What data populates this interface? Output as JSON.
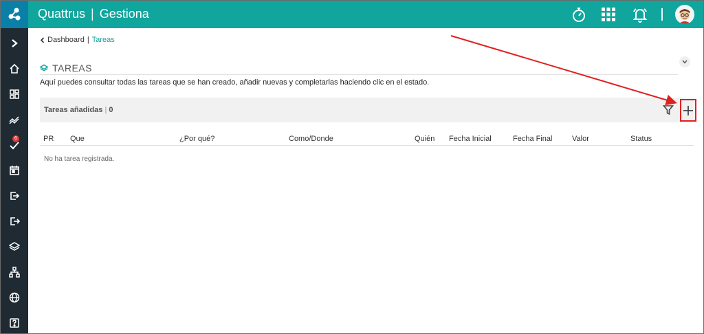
{
  "header": {
    "brand_name": "Quattrus",
    "brand_separator": "|",
    "module_name": "Gestiona",
    "icons": [
      "timer-icon",
      "apps-grid-icon",
      "bell-icon",
      "user-avatar"
    ]
  },
  "sidebar": {
    "items": [
      {
        "name": "expand-chevron-icon"
      },
      {
        "name": "home-icon"
      },
      {
        "name": "dashboard-icon"
      },
      {
        "name": "trend-icon"
      },
      {
        "name": "tasks-check-icon",
        "badge": "6"
      },
      {
        "name": "calendar-icon"
      },
      {
        "name": "login-icon"
      },
      {
        "name": "logout-icon"
      },
      {
        "name": "layers-icon"
      },
      {
        "name": "org-chart-icon"
      },
      {
        "name": "globe-icon"
      },
      {
        "name": "help-icon"
      }
    ]
  },
  "breadcrumb": {
    "back_label": "Dashboard",
    "separator": "|",
    "current_label": "Tareas"
  },
  "page": {
    "title": "TAREAS",
    "description": "Aquí puedes consultar todas las tareas que se han creado, añadir nuevas y completarlas haciendo clic en el estado."
  },
  "panel": {
    "title": "Tareas añadidas",
    "separator": "|",
    "count": "0"
  },
  "table": {
    "columns": [
      "PR",
      "Que",
      "¿Por qué?",
      "Como/Donde",
      "Quién",
      "Fecha Inicial",
      "Fecha Final",
      "Valor",
      "Status"
    ],
    "empty_message": "No ha tarea registrada."
  },
  "colors": {
    "topbar": "#10a59d",
    "logo_box": "#0a7fa8",
    "sidebar": "#1f2a33",
    "accent_link": "#10a59d",
    "highlight": "#e02020"
  }
}
